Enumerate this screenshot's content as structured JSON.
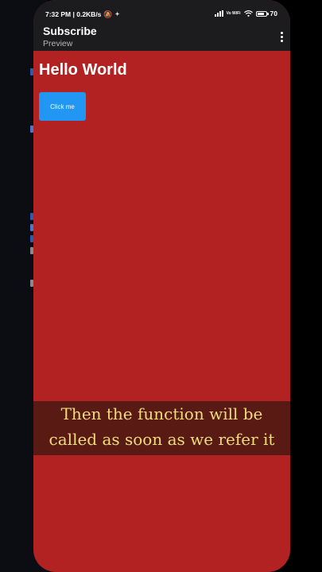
{
  "status_bar": {
    "time_and_speed": "7:32 PM | 0.2KB/s",
    "network_label": "Vo WiFi",
    "battery_level": "70"
  },
  "app_bar": {
    "title": "Subscribe",
    "subtitle": "Preview"
  },
  "preview": {
    "heading": "Hello World",
    "button_label": "Click me",
    "background_color": "#b22222",
    "button_color": "#2196f3"
  },
  "caption": {
    "line1": "Then the function will be",
    "line2": "called as soon as we refer it",
    "text_color": "#f1dc7d"
  },
  "icons": {
    "status": [
      "mute-icon",
      "signal-icon",
      "wifi-icon",
      "battery-icon"
    ],
    "app_bar": [
      "more-vert-icon"
    ]
  }
}
